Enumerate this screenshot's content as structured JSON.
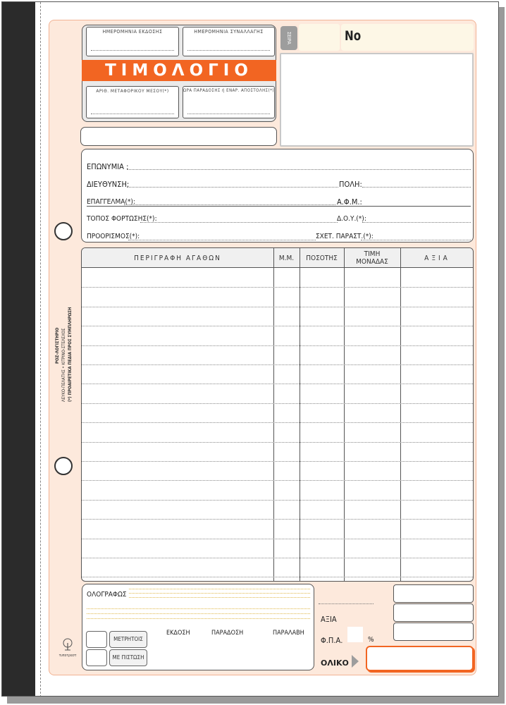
{
  "header": {
    "issue_date_label": "ΗΜΕΡΟΜΗΝΙΑ ΕΚΔΟΣΗΣ",
    "transaction_date_label": "ΗΜΕΡΟΜΗΝΙΑ ΣΥΝΑΛΛΑΓΗΣ",
    "title": "ΤΙΜΟΛΟΓΙΟ",
    "vehicle_no_label": "ΑΡΙΘ. ΜΕΤΑΦΟΡΙΚΟΥ ΜΕΣΟΥ(*)",
    "delivery_time_label": "ΩΡΑ ΠΑΡΑΔΟΣΗΣ ή ΕΝΑΡ. ΑΠΟΣΤΟΛΗΣ(*)",
    "series_label": "ΣΕΙΡΑ",
    "number_label": "No"
  },
  "customer": {
    "name_label": "ΕΠΩΝΥΜΙΑ :",
    "address_label": "ΔΙΕΥΘΥΝΣΗ:",
    "city_label": "ΠΟΛΗ:",
    "profession_label": "ΕΠΑΓΓΕΛΜΑ(*):",
    "vat_no_label": "Α.Φ.Μ.:",
    "loading_place_label": "ΤΟΠΟΣ ΦΟΡΤΩΣΗΣ(*):",
    "tax_office_label": "Δ.Ο.Υ.(*):",
    "destination_label": "ΠΡΟΟΡΙΣΜΟΣ(*):",
    "related_doc_label": "ΣΧΕΤ. ΠΑΡΑΣΤ.(*):"
  },
  "table": {
    "columns": [
      "ΠΕΡΙΓΡΑΦΗ ΑΓΑΘΩΝ",
      "Μ.Μ.",
      "ΠΟΣΟΤΗΣ",
      "ΤΙΜΗ ΜΟΝΑΔΑΣ",
      "ΑΞΙΑ"
    ]
  },
  "side_note": {
    "line1": "ΡΟΖ-ΛΟΓΙΣΤΗΡΙΟ",
    "line2": "ΛΕΥΚΟ-ΠΕΛΑΤΗΣ • ΚΙΤΡΙΝΟ-ΣΤΕΛΕΧΟΣ",
    "line3": "(*) ΠΡΟΑΙΡΕΤΙΚΑ ΠΕΔΙΑ ΠΡΟΣ ΣΥΜΠΛΗΡΩΣΗ"
  },
  "footer": {
    "in_words_label": "ΟΛΟΓΡΑΦΩΣ",
    "cash_label": "ΜΕΤΡΗΤΟΙΣ",
    "credit_label": "ΜΕ ΠΙΣΤΩΣΗ",
    "issued_label": "ΕΚΔΟΣΗ",
    "delivered_label": "ΠΑΡΑΔΟΣΗ",
    "received_label": "ΠΑΡΑΛΑΒΗ",
    "value_label": "ΑΞΙΑ",
    "vat_label": "Φ.Π.Α.",
    "percent_sign": "%",
    "total_label": "ΟΛΙΚΟ",
    "brand": "τυποτραστ"
  },
  "colors": {
    "accent": "#f26522",
    "form_bg": "#fde9dc",
    "binding": "#2b2b2b"
  }
}
